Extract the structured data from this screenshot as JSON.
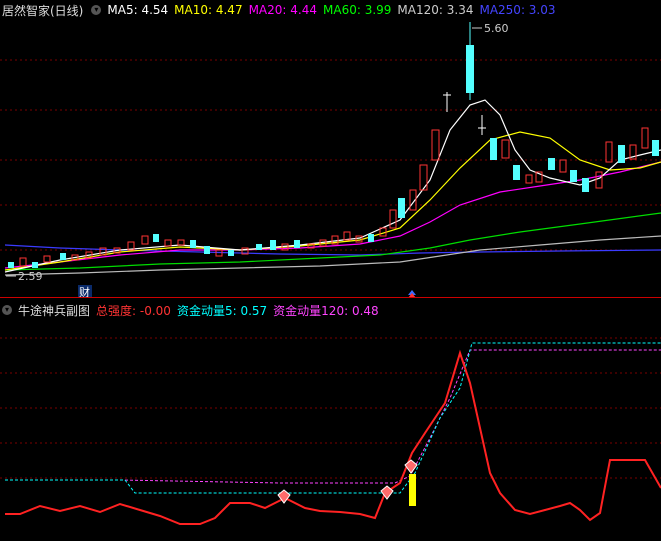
{
  "main_chart": {
    "title": "居然智家(日线)",
    "ma_labels": [
      {
        "name": "MA5",
        "value": "4.54",
        "color": "#ffffff"
      },
      {
        "name": "MA10",
        "value": "4.47",
        "color": "#ffff00"
      },
      {
        "name": "MA20",
        "value": "4.44",
        "color": "#ff00ff"
      },
      {
        "name": "MA60",
        "value": "3.99",
        "color": "#00ff00"
      },
      {
        "name": "MA120",
        "value": "3.34",
        "color": "#cccccc"
      },
      {
        "name": "MA250",
        "value": "3.03",
        "color": "#4444ff"
      }
    ],
    "high_label": "5.60",
    "low_label": "2.59",
    "event_marker": "财"
  },
  "sub_chart": {
    "title": "牛途神兵副图",
    "indicators": [
      {
        "name": "总强度",
        "value": "-0.00",
        "color": "#ff3333"
      },
      {
        "name": "资金动量5",
        "value": "0.57",
        "color": "#00ffff"
      },
      {
        "name": "资金动量120",
        "value": "0.48",
        "color": "#ff44ff"
      }
    ]
  },
  "colors": {
    "up": "#ff3333",
    "down": "#54ffff",
    "grid": "#7a0000"
  }
}
